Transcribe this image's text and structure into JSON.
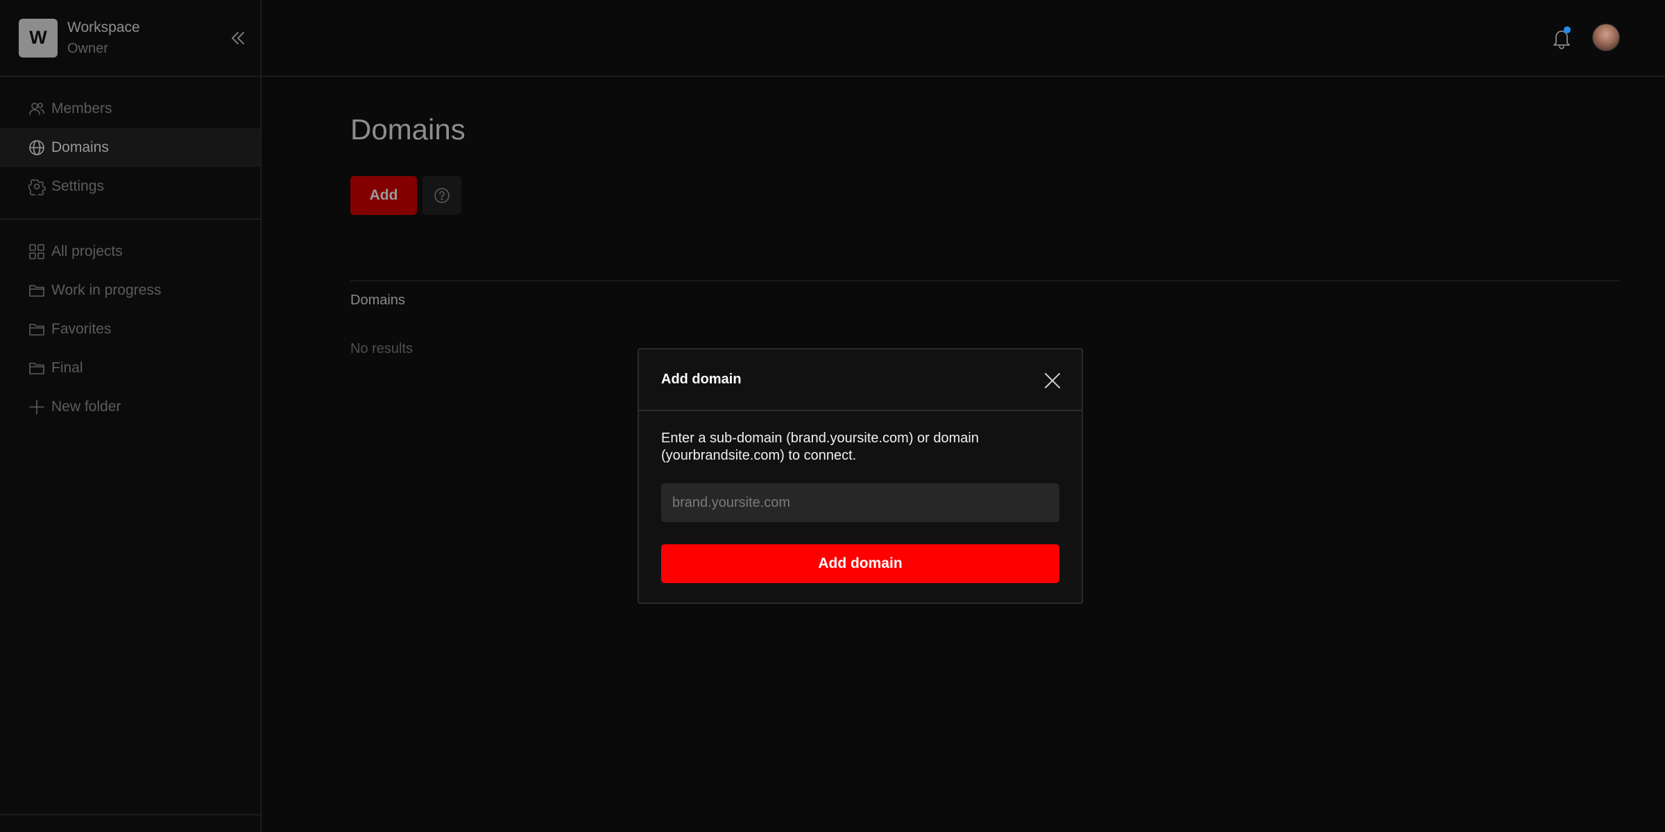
{
  "workspace": {
    "logo_letter": "W",
    "name": "Workspace",
    "role": "Owner"
  },
  "sidebar": {
    "admin_items": [
      {
        "label": "Members",
        "icon": "members-icon"
      },
      {
        "label": "Domains",
        "icon": "globe-icon",
        "active": true
      },
      {
        "label": "Settings",
        "icon": "gear-icon"
      }
    ],
    "project_items": [
      {
        "label": "All projects",
        "icon": "grid-icon"
      },
      {
        "label": "Work in progress",
        "icon": "folder-icon"
      },
      {
        "label": "Favorites",
        "icon": "folder-icon"
      },
      {
        "label": "Final",
        "icon": "folder-icon"
      },
      {
        "label": "New folder",
        "icon": "plus-icon"
      }
    ]
  },
  "topbar": {
    "has_unread_notifications": true
  },
  "main": {
    "title": "Domains",
    "add_label": "Add",
    "section_label": "Domains",
    "empty_text": "No results"
  },
  "modal": {
    "title": "Add domain",
    "description": "Enter a sub-domain (brand.yoursite.com) or domain (yourbrandsite.com) to connect.",
    "input_placeholder": "brand.yoursite.com",
    "input_value": "",
    "submit_label": "Add domain"
  },
  "colors": {
    "background": "#0a0a0a",
    "accent_red": "#ff0000",
    "dimmed_red": "#830000",
    "notification_dot": "#1f8ef1"
  }
}
